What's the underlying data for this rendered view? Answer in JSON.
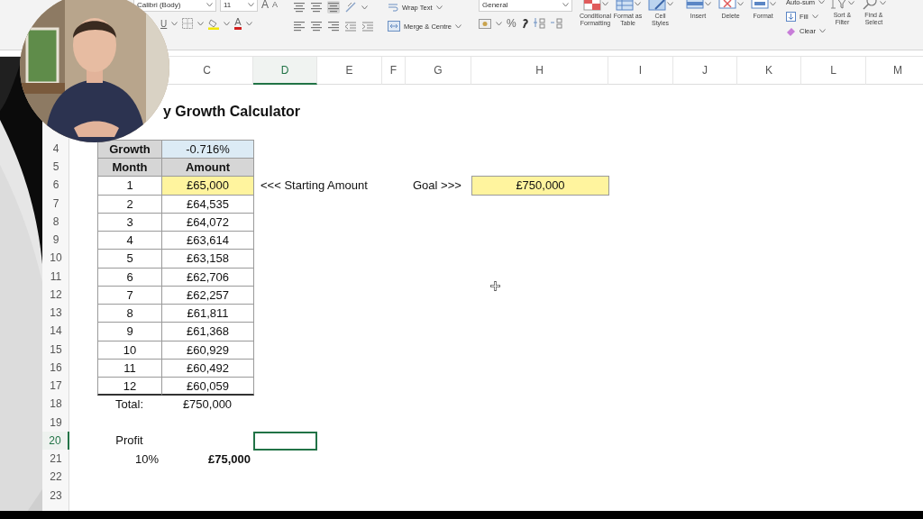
{
  "ribbon": {
    "font_group": {
      "font": "Calibri (Body)",
      "size": "11",
      "grow": "A",
      "shrink": "A",
      "underline": "U",
      "font_color": "A"
    },
    "alignment_group": {
      "wrap": "Wrap Text",
      "merge": "Merge & Centre"
    },
    "number_group": {
      "format": "General",
      "percent": "%"
    },
    "styles_group": [
      "Conditional Formatting",
      "Format as Table",
      "Cell Styles"
    ],
    "cells_group": [
      "Insert",
      "Delete",
      "Format"
    ],
    "editing_group": {
      "autosum": "Auto-sum",
      "fill": "Fill",
      "clear": "Clear",
      "buttons": [
        "Sort & Filter",
        "Find & Select"
      ]
    }
  },
  "sheet": {
    "columns": [
      {},
      {},
      {
        "label": "C",
        "selected": false
      },
      {
        "label": "D",
        "selected": true
      },
      {
        "label": "E",
        "selected": false
      },
      {
        "label": "F",
        "selected": false
      },
      {
        "label": "G",
        "selected": false
      },
      {
        "label": "H",
        "selected": false
      },
      {
        "label": "I",
        "selected": false
      },
      {
        "label": "J",
        "selected": false
      },
      {
        "label": "K",
        "selected": false
      },
      {
        "label": "L",
        "selected": false
      },
      {
        "label": "M",
        "selected": false
      }
    ],
    "rows": [
      {
        "cells": [
          {
            "kind": "blank"
          },
          {
            "kind": "blank"
          },
          {
            "kind": "title",
            "text": "y Growth Calculator"
          }
        ]
      },
      {
        "cells": []
      },
      {
        "number": "4",
        "selected": false,
        "cells": [
          {
            "kind": "blank"
          },
          {
            "kind": "header",
            "text": "Growth"
          },
          {
            "kind": "blue",
            "text": "-0.716%"
          }
        ]
      },
      {
        "number": "5",
        "selected": false,
        "cells": [
          {
            "kind": "blank"
          },
          {
            "kind": "header",
            "text": "Month"
          },
          {
            "kind": "header",
            "text": "Amount"
          }
        ]
      },
      {
        "number": "6",
        "selected": false,
        "cells": [
          {
            "kind": "blank"
          },
          {
            "kind": "table",
            "text": "1"
          },
          {
            "kind": "yellow",
            "text": "£65,000"
          },
          {
            "kind": "text",
            "text": "<<<  Starting Amount"
          },
          {
            "kind": "blank"
          },
          {
            "kind": "blank"
          },
          {
            "kind": "text",
            "text": "Goal  >>>"
          },
          {
            "kind": "yellow",
            "text": "£750,000"
          }
        ]
      },
      {
        "number": "7",
        "selected": false,
        "cells": [
          {
            "kind": "blank"
          },
          {
            "kind": "table",
            "text": "2"
          },
          {
            "kind": "table",
            "text": "£64,535"
          }
        ]
      },
      {
        "number": "8",
        "selected": false,
        "cells": [
          {
            "kind": "blank"
          },
          {
            "kind": "table",
            "text": "3"
          },
          {
            "kind": "table",
            "text": "£64,072"
          }
        ]
      },
      {
        "number": "9",
        "selected": false,
        "cells": [
          {
            "kind": "blank"
          },
          {
            "kind": "table",
            "text": "4"
          },
          {
            "kind": "table",
            "text": "£63,614"
          }
        ]
      },
      {
        "number": "10",
        "selected": false,
        "cells": [
          {
            "kind": "blank"
          },
          {
            "kind": "table",
            "text": "5"
          },
          {
            "kind": "table",
            "text": "£63,158"
          }
        ]
      },
      {
        "number": "11",
        "selected": false,
        "cells": [
          {
            "kind": "blank"
          },
          {
            "kind": "table",
            "text": "6"
          },
          {
            "kind": "table",
            "text": "£62,706"
          }
        ]
      },
      {
        "number": "12",
        "selected": false,
        "cells": [
          {
            "kind": "blank"
          },
          {
            "kind": "table",
            "text": "7"
          },
          {
            "kind": "table",
            "text": "£62,257"
          }
        ]
      },
      {
        "number": "13",
        "selected": false,
        "cells": [
          {
            "kind": "blank"
          },
          {
            "kind": "table",
            "text": "8"
          },
          {
            "kind": "table",
            "text": "£61,811"
          }
        ]
      },
      {
        "number": "14",
        "selected": false,
        "cells": [
          {
            "kind": "blank"
          },
          {
            "kind": "table",
            "text": "9"
          },
          {
            "kind": "table",
            "text": "£61,368"
          }
        ]
      },
      {
        "number": "15",
        "selected": false,
        "cells": [
          {
            "kind": "blank"
          },
          {
            "kind": "table",
            "text": "10"
          },
          {
            "kind": "table",
            "text": "£60,929"
          }
        ]
      },
      {
        "number": "16",
        "selected": false,
        "cells": [
          {
            "kind": "blank"
          },
          {
            "kind": "table",
            "text": "11"
          },
          {
            "kind": "table",
            "text": "£60,492"
          }
        ]
      },
      {
        "number": "17",
        "selected": false,
        "cells": [
          {
            "kind": "blank"
          },
          {
            "kind": "table-end",
            "text": "12"
          },
          {
            "kind": "table-end",
            "text": "£60,059"
          }
        ]
      },
      {
        "number": "18",
        "selected": false,
        "cells": [
          {
            "kind": "blank"
          },
          {
            "kind": "center",
            "text": "Total:"
          },
          {
            "kind": "center",
            "text": "£750,000"
          }
        ]
      },
      {
        "number": "19",
        "selected": false,
        "cells": []
      },
      {
        "number": "20",
        "selected": true,
        "cells": [
          {
            "kind": "blank"
          },
          {
            "kind": "center",
            "text": "Profit"
          }
        ]
      },
      {
        "number": "21",
        "selected": false,
        "cells": [
          {
            "kind": "blank"
          },
          {
            "kind": "right",
            "text": "10%"
          },
          {
            "kind": "bold-right",
            "text": "£75,000"
          }
        ]
      },
      {
        "number": "22",
        "selected": false,
        "cells": []
      },
      {
        "number": "23",
        "selected": false,
        "cells": []
      }
    ]
  }
}
